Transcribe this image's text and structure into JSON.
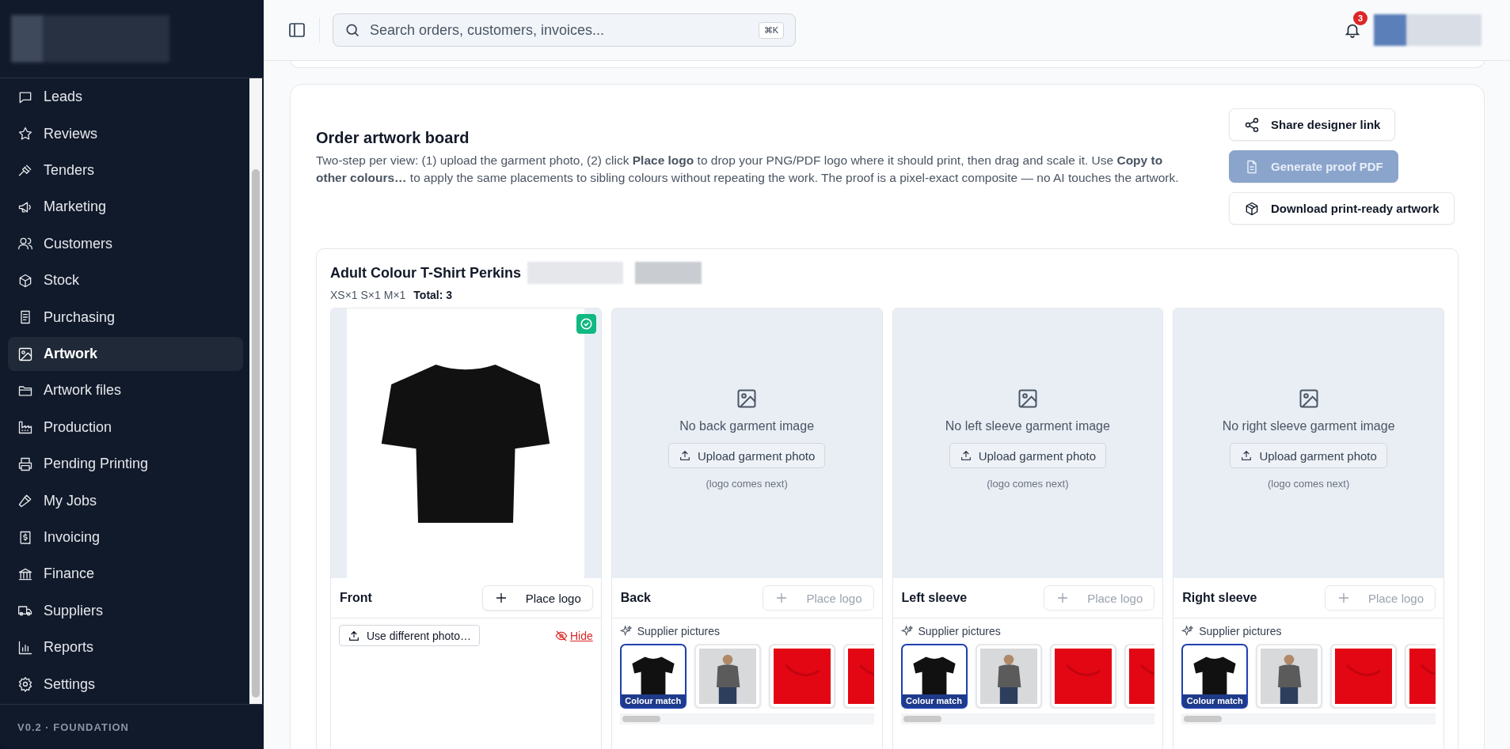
{
  "sidebar": {
    "items": [
      {
        "label": "Leads",
        "selected": false
      },
      {
        "label": "Reviews",
        "selected": false
      },
      {
        "label": "Tenders",
        "selected": false
      },
      {
        "label": "Marketing",
        "selected": false
      },
      {
        "label": "Customers",
        "selected": false
      },
      {
        "label": "Stock",
        "selected": false
      },
      {
        "label": "Purchasing",
        "selected": false
      },
      {
        "label": "Artwork",
        "selected": true
      },
      {
        "label": "Artwork files",
        "selected": false
      },
      {
        "label": "Production",
        "selected": false
      },
      {
        "label": "Pending Printing",
        "selected": false
      },
      {
        "label": "My Jobs",
        "selected": false
      },
      {
        "label": "Invoicing",
        "selected": false
      },
      {
        "label": "Finance",
        "selected": false
      },
      {
        "label": "Suppliers",
        "selected": false
      },
      {
        "label": "Reports",
        "selected": false
      },
      {
        "label": "Settings",
        "selected": false
      }
    ],
    "footer": "V0.2 · FOUNDATION"
  },
  "header": {
    "search": {
      "placeholder": "Search orders, customers, invoices...",
      "shortcut": "⌘K"
    },
    "notifications": "3"
  },
  "board": {
    "title": "Order artwork board",
    "description": "Two-step per view: (1) upload the garment photo, (2) click **Place logo** to drop your PNG/PDF logo where it should print, then drag and scale it. Use **Copy to other colours…** to apply the same placements to sibling colours without repeating the work. The proof is a pixel-exact composite — no AI touches the artwork.",
    "actions": [
      {
        "label": "Share designer link",
        "disabled": false
      },
      {
        "label": "Generate proof PDF",
        "disabled": true
      },
      {
        "label": "Download print-ready artwork",
        "disabled": false
      }
    ]
  },
  "product": {
    "title": "Adult Colour T-Shirt Perkins",
    "sizes": "XS×1 S×1 M×1",
    "total": "Total: 3",
    "views": [
      {
        "kind": "photo",
        "label": "Front",
        "approved": true,
        "place_logo": {
          "label": "Place logo",
          "disabled": false
        },
        "change_photo": "Use different photo…",
        "hide": "Hide"
      },
      {
        "kind": "empty",
        "label": "Back",
        "empty_text": "No back garment image",
        "upload": "Upload garment photo",
        "hint": "(logo comes next)",
        "place_logo": {
          "label": "Place logo",
          "disabled": true
        },
        "supplier_label": "Supplier pictures",
        "thumbnails": [
          {
            "kind": "black-tee",
            "badge": "Colour match",
            "selected": true
          },
          {
            "kind": "model",
            "selected": false
          },
          {
            "kind": "red-fabric",
            "selected": false
          },
          {
            "kind": "red-fabric",
            "selected": false
          }
        ]
      },
      {
        "kind": "empty",
        "label": "Left sleeve",
        "empty_text": "No left sleeve garment image",
        "upload": "Upload garment photo",
        "hint": "(logo comes next)",
        "place_logo": {
          "label": "Place logo",
          "disabled": true
        },
        "supplier_label": "Supplier pictures",
        "thumbnails": [
          {
            "kind": "black-tee",
            "badge": "Colour match",
            "selected": true
          },
          {
            "kind": "model",
            "selected": false
          },
          {
            "kind": "red-fabric",
            "selected": false
          },
          {
            "kind": "red-fabric",
            "selected": false
          }
        ]
      },
      {
        "kind": "empty",
        "label": "Right sleeve",
        "empty_text": "No right sleeve garment image",
        "upload": "Upload garment photo",
        "hint": "(logo comes next)",
        "place_logo": {
          "label": "Place logo",
          "disabled": true
        },
        "supplier_label": "Supplier pictures",
        "thumbnails": [
          {
            "kind": "black-tee",
            "badge": "Colour match",
            "selected": true
          },
          {
            "kind": "model",
            "selected": false
          },
          {
            "kind": "red-fabric",
            "selected": false
          },
          {
            "kind": "red-fabric",
            "selected": false
          }
        ]
      }
    ]
  }
}
